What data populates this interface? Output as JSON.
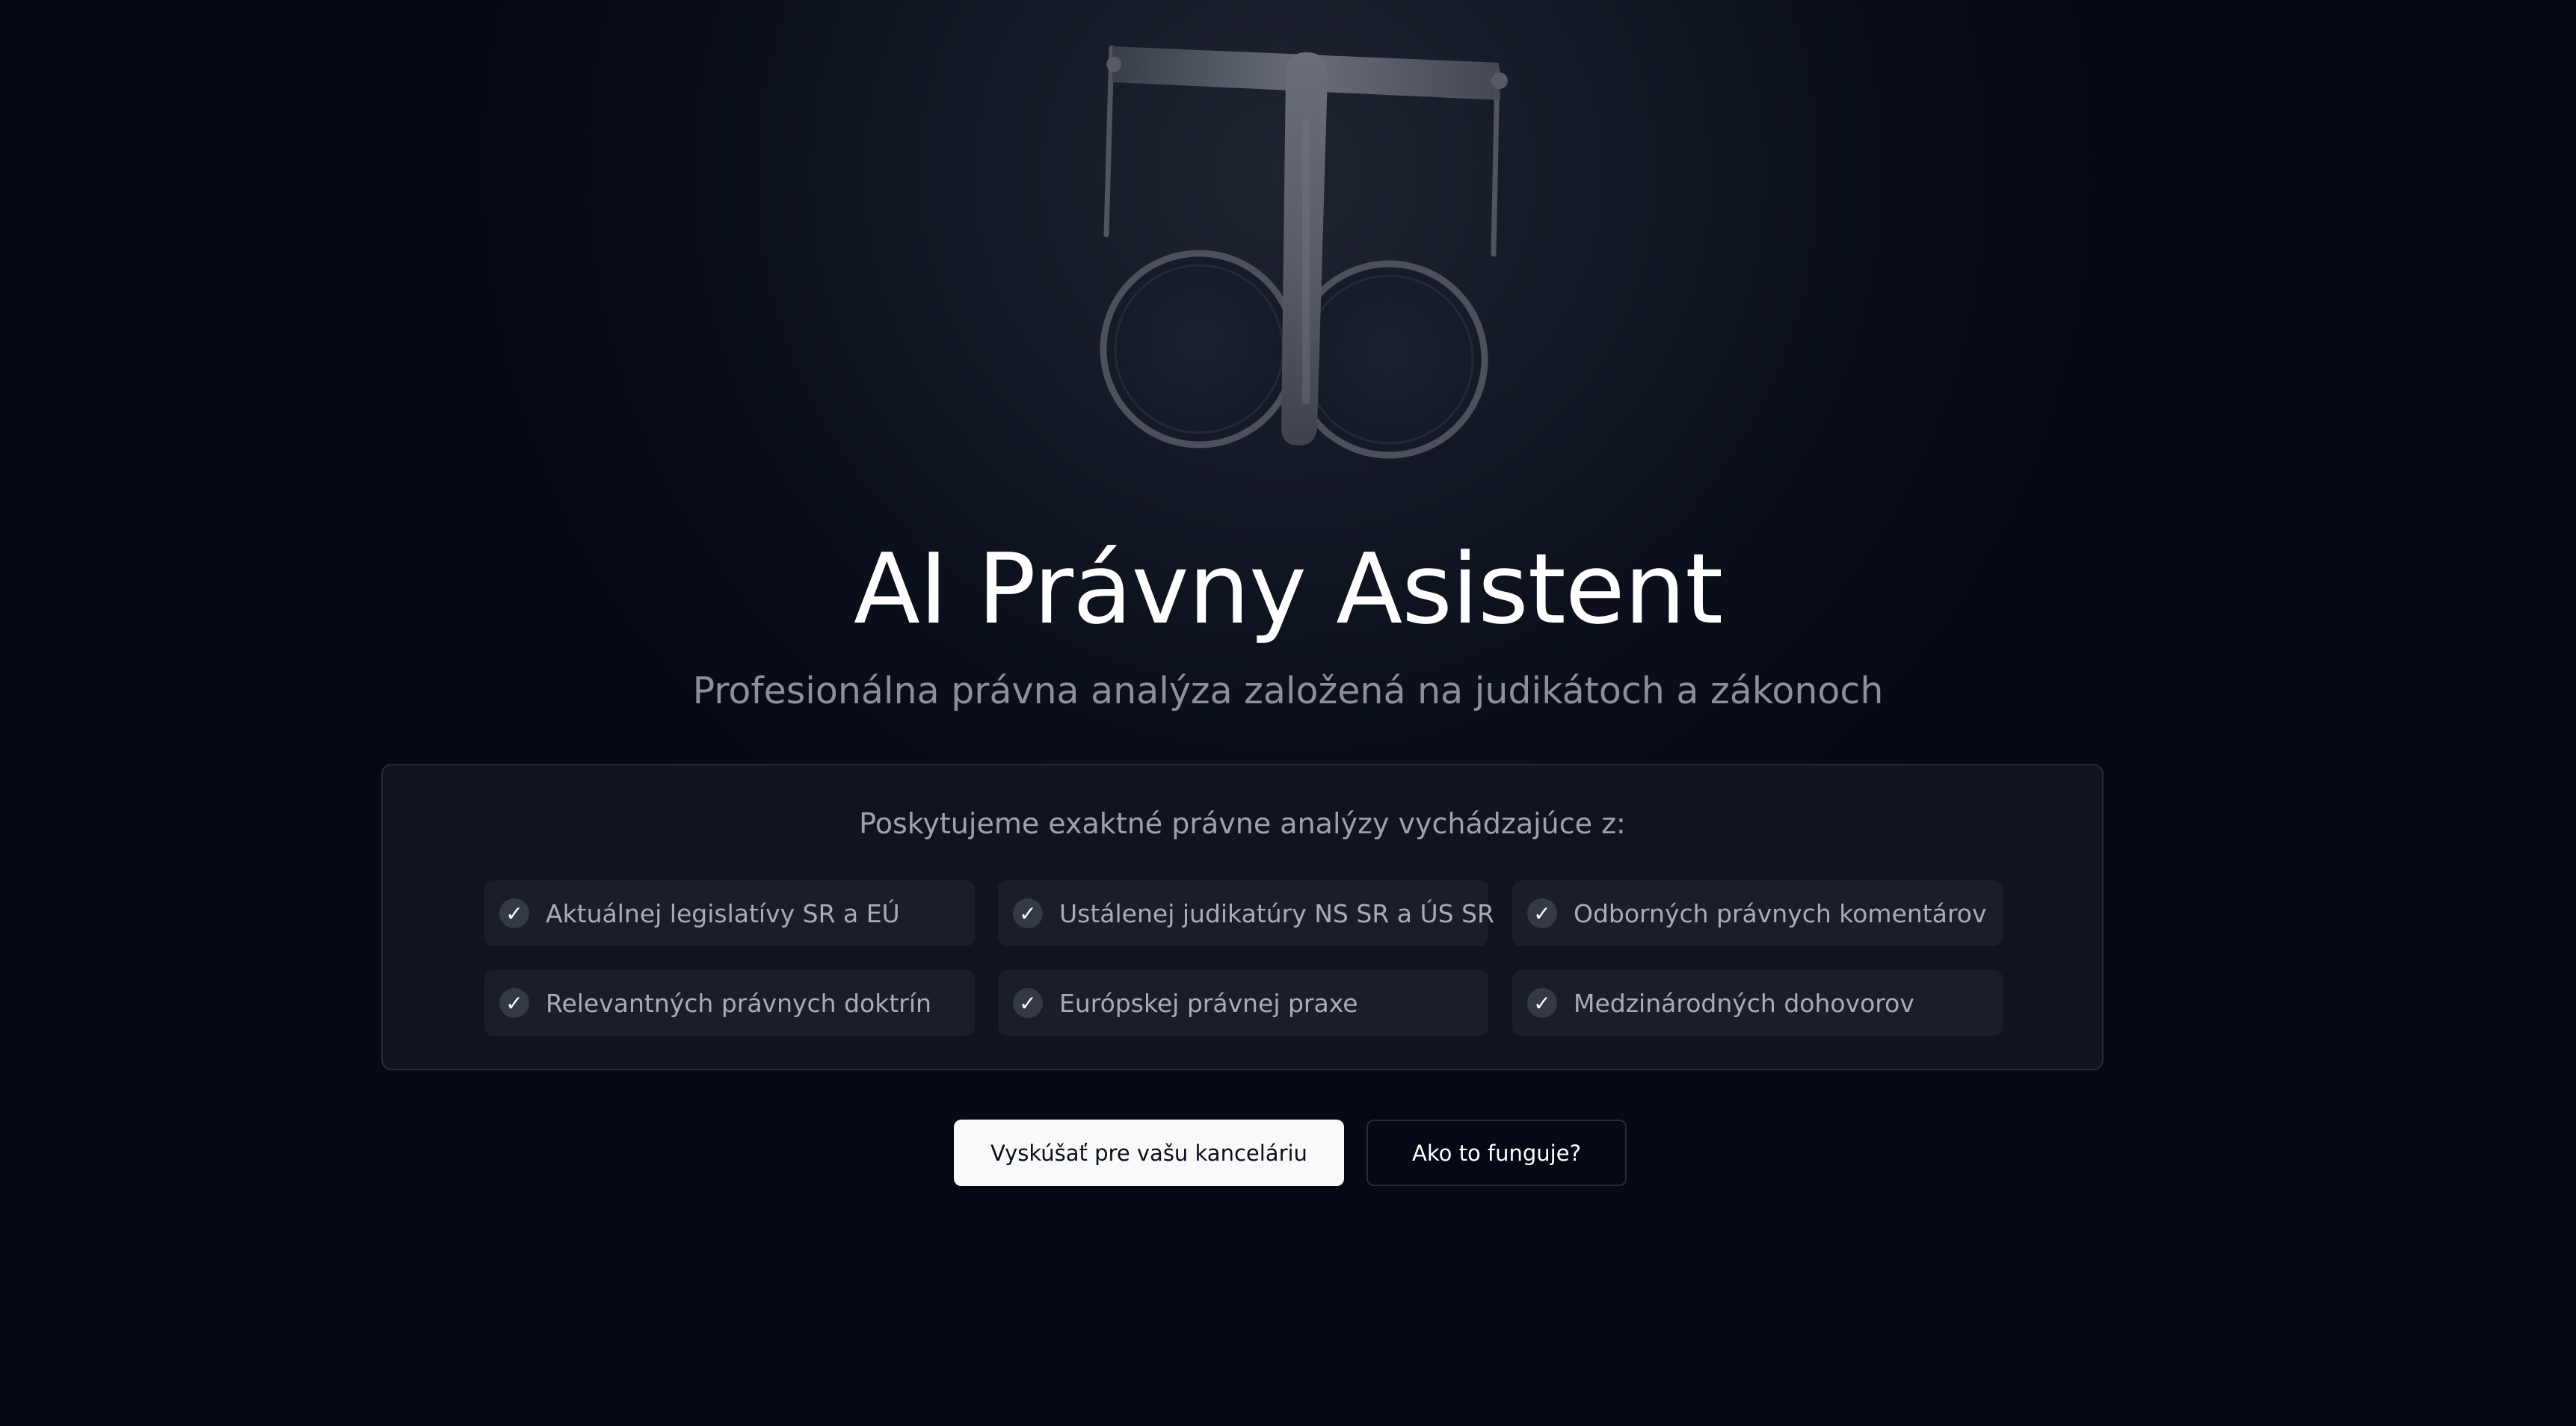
{
  "hero": {
    "title": "AI Právny Asistent",
    "subtitle": "Profesionálna právna analýza založená na judikátoch a zákonoch"
  },
  "logo": {
    "icon": "scales-of-justice-icon"
  },
  "features_panel": {
    "heading": "Poskytujeme exaktné právne analýzy vychádzajúce z:",
    "check_glyph": "✓",
    "items": [
      {
        "label": "Aktuálnej legislatívy SR a EÚ"
      },
      {
        "label": "Ustálenej judikatúry NS SR a ÚS SR"
      },
      {
        "label": "Odborných právnych komentárov"
      },
      {
        "label": "Relevantných právnych doktrín"
      },
      {
        "label": "Európskej právnej praxe"
      },
      {
        "label": "Medzinárodných dohovorov"
      }
    ]
  },
  "actions": {
    "primary_label": "Vyskúšať pre vašu kanceláriu",
    "secondary_label": "Ako to funguje?"
  },
  "colors": {
    "background": "#050913",
    "panel": "#0f1420",
    "primary_button": "#f8f9fb",
    "muted_text": "#8c909c"
  }
}
